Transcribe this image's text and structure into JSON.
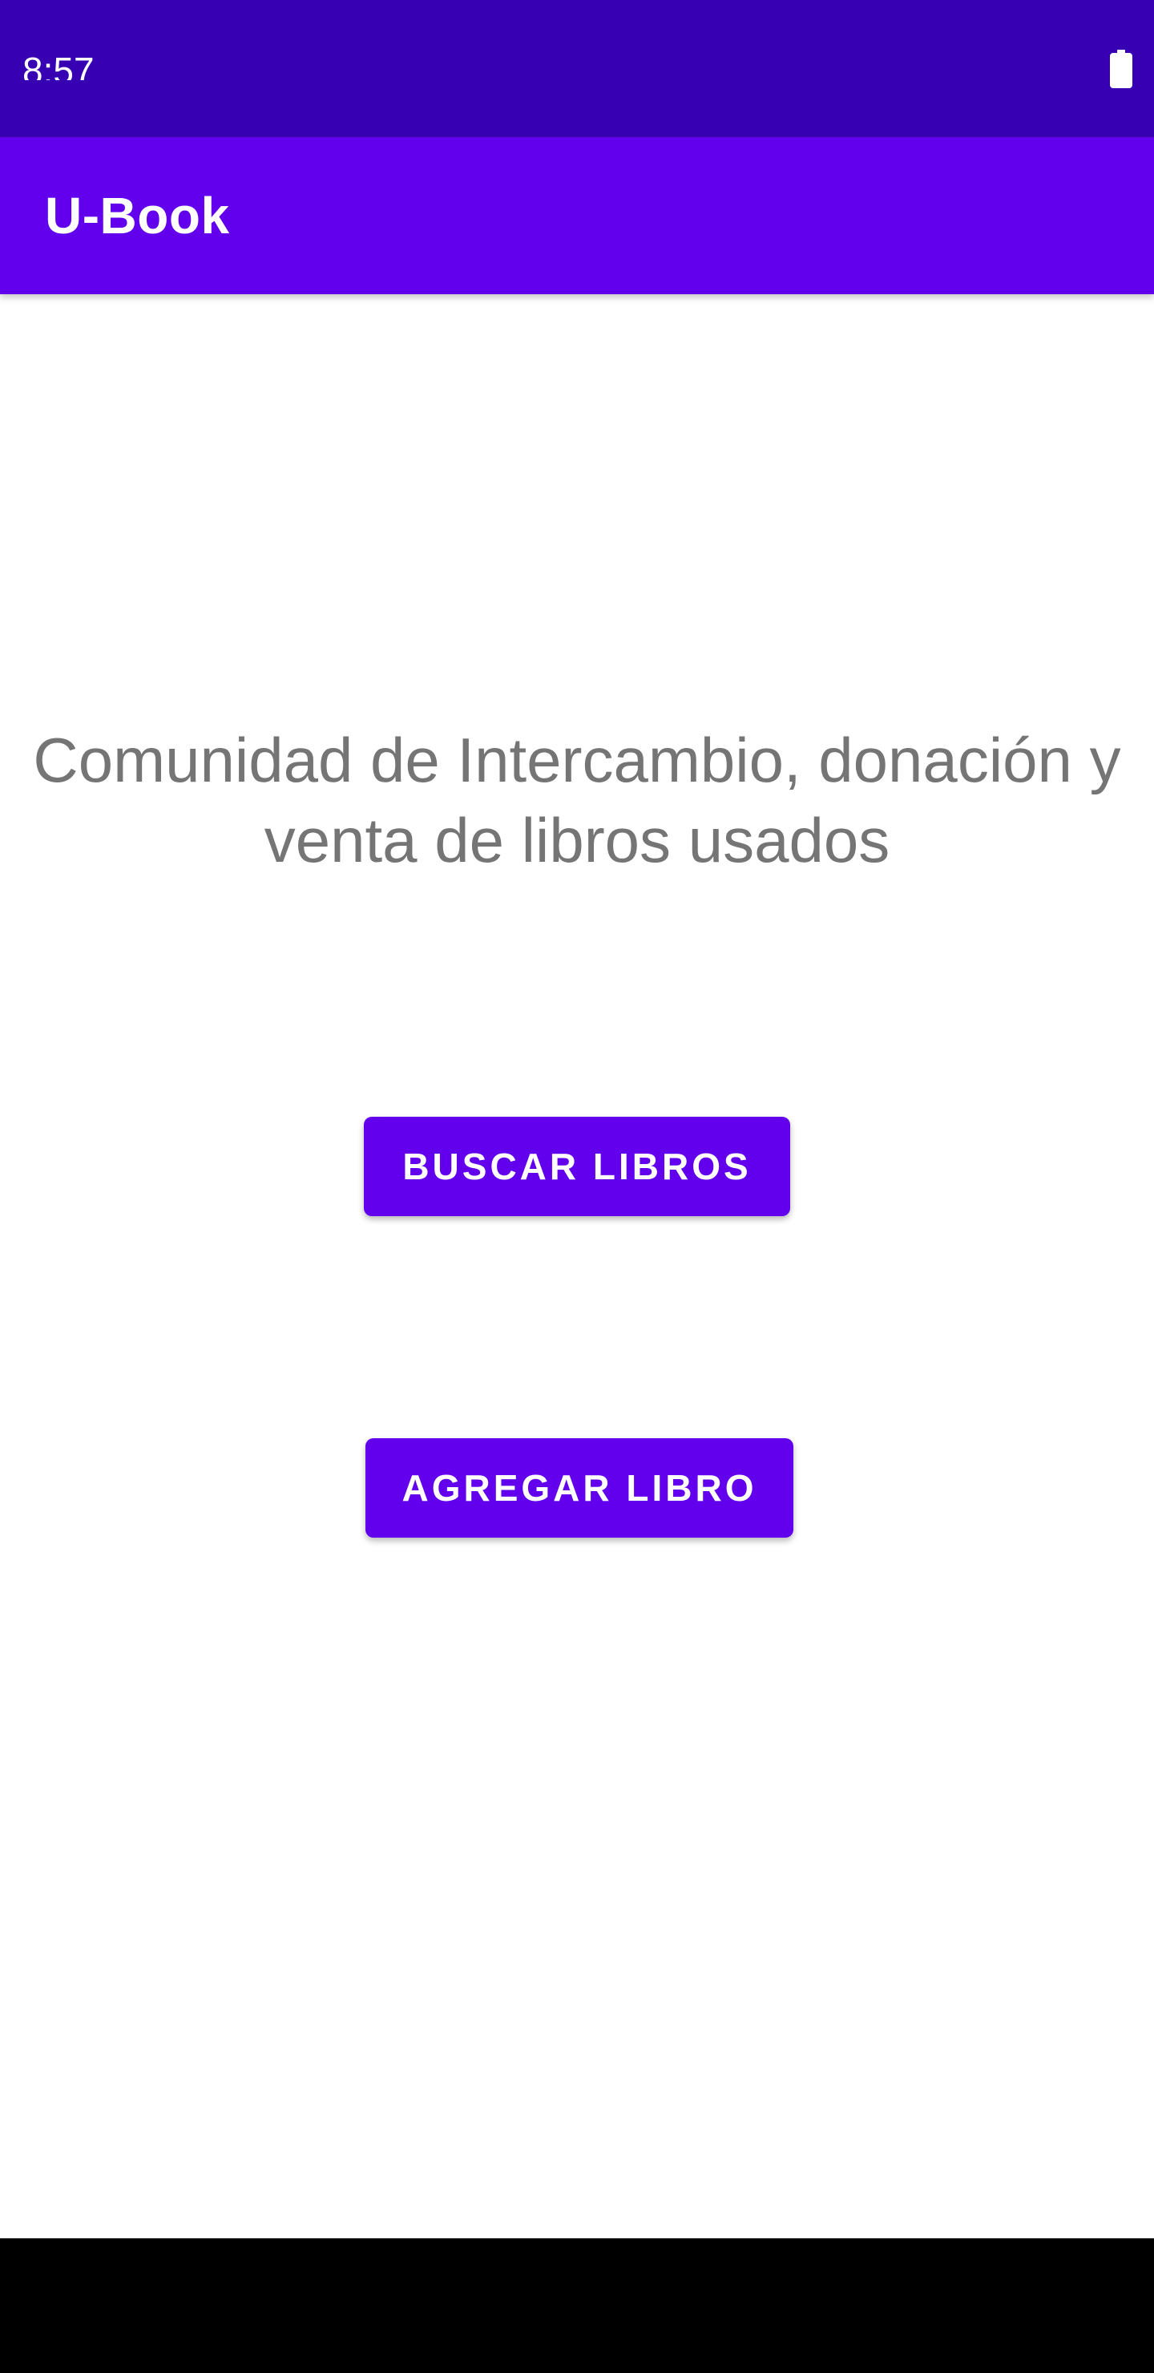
{
  "status_bar": {
    "time": "8:57",
    "battery_icon": "battery-full-icon",
    "color": "#3700b3"
  },
  "app_bar": {
    "title": "U-Book",
    "color": "#6200ee"
  },
  "main": {
    "tagline": "Comunidad de Intercambio, donación y venta de libros usados",
    "buttons": {
      "search_label": "BUSCAR LIBROS",
      "add_label": "AGREGAR LIBRO"
    },
    "button_color": "#6200ee",
    "tagline_color": "#757575"
  },
  "nav_bar": {
    "color": "#000000"
  }
}
